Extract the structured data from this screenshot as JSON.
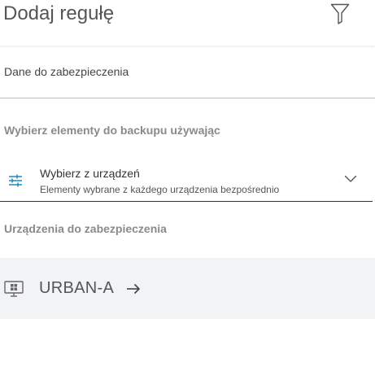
{
  "header": {
    "title": "Dodaj regułę",
    "filter_icon": "filter-icon"
  },
  "form": {
    "field_label": "Dane do zabezpieczenia",
    "backup_method_heading": "Wybierz elementy do backupu używając",
    "select": {
      "title": "Wybierz z urządzeń",
      "description": "Elementy wybrane z każdego urządzenia bezpośrednio",
      "icon": "sliders-icon",
      "chevron_icon": "chevron-down-icon"
    },
    "devices_heading": "Urządzenia do zabezpieczenia",
    "devices": [
      {
        "name": "URBAN-A",
        "icon": "windows-computer-icon",
        "arrow_icon": "arrow-right-icon"
      }
    ]
  },
  "colors": {
    "accent": "#1e88c7",
    "device_row_bg": "#f1f3f5",
    "heading_gray": "#8a8a8a"
  }
}
